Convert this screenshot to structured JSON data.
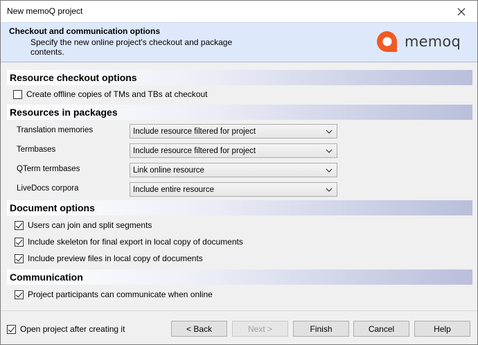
{
  "window": {
    "title": "New memoQ project"
  },
  "header": {
    "title": "Checkout and communication options",
    "subtitle": "Specify the new online project's checkout and package contents.",
    "logo_text": "memoq",
    "logo_color": "#f15a24"
  },
  "sections": {
    "resource_checkout": {
      "label": "Resource checkout options",
      "offline_copies": {
        "label": "Create offline copies of TMs and TBs at checkout",
        "checked": false
      }
    },
    "resources_in_packages": {
      "label": "Resources in packages",
      "rows": [
        {
          "label": "Translation memories",
          "value": "Include resource filtered for project"
        },
        {
          "label": "Termbases",
          "value": "Include resource filtered for project"
        },
        {
          "label": "QTerm termbases",
          "value": "Link online resource"
        },
        {
          "label": "LiveDocs corpora",
          "value": "Include entire resource"
        }
      ]
    },
    "document_options": {
      "label": "Document options",
      "options": [
        {
          "label": "Users can join and split segments",
          "checked": true
        },
        {
          "label": "Include skeleton for final export in local copy of documents",
          "checked": true
        },
        {
          "label": "Include preview files in local copy of documents",
          "checked": true
        }
      ]
    },
    "communication": {
      "label": "Communication",
      "option": {
        "label": "Project participants can communicate when online",
        "checked": true
      }
    }
  },
  "footer": {
    "open_project": {
      "label": "Open project after creating it",
      "checked": true
    },
    "buttons": {
      "back": "< Back",
      "next": "Next >",
      "finish": "Finish",
      "cancel": "Cancel",
      "help": "Help"
    }
  }
}
